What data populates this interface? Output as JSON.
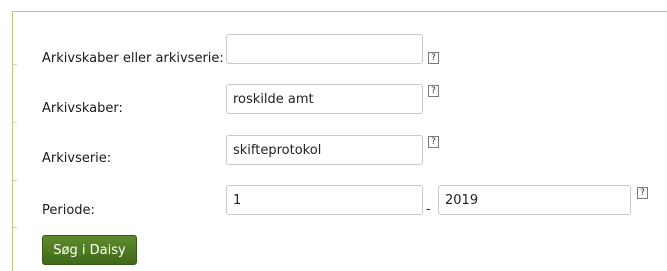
{
  "form": {
    "fields": {
      "creator_or_series": {
        "label": "Arkivskaber eller arkivserie:",
        "value": ""
      },
      "creator": {
        "label": "Arkivskaber:",
        "value": "roskilde amt"
      },
      "series": {
        "label": "Arkivserie:",
        "value": "skifteprotokol"
      },
      "period": {
        "label": "Periode:",
        "from": "1",
        "separator": "-",
        "to": "2019"
      }
    },
    "help_icon_text": "?",
    "submit_label": "Søg i Daisy"
  }
}
